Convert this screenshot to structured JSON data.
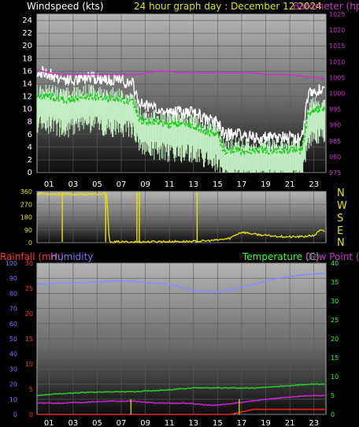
{
  "header": {
    "wind_title": "Windspeed (kts)",
    "graph_title": "24 hour graph day : December 12 2024",
    "barometer_title": "Barometer (hpa)"
  },
  "bottom_header": {
    "rainfall_title": "Rainfall (mm)",
    "humidity_title": "Humidity",
    "temperature_title": "Temperature (C)",
    "dewpoint_title": "Dew Point (C)"
  },
  "compass": [
    "N",
    "W",
    "S",
    "E",
    "N"
  ],
  "hour_labels": [
    "01",
    "03",
    "05",
    "07",
    "09",
    "11",
    "13",
    "15",
    "17",
    "19",
    "21",
    "23"
  ],
  "colors": {
    "wind_gust": "#ffffff",
    "wind_avg_band": "#c8f5c8",
    "wind_avg_line": "#22cc22",
    "barometer": "#cc33cc",
    "direction": "#e5e500",
    "humidity": "#8a8aff",
    "temperature": "#22cc22",
    "dewpoint": "#cc22cc",
    "rainfall": "#ee2222",
    "rain_axis": "#ff3333",
    "humidity_axis": "#7777ff",
    "temp_axis": "#33ff33"
  },
  "chart_data": [
    {
      "type": "line",
      "panel": "wind",
      "x_hours": [
        0,
        1,
        2,
        3,
        4,
        5,
        6,
        7,
        8,
        8.5,
        9,
        10,
        11,
        12,
        13,
        14,
        15,
        15.5,
        16,
        17,
        18,
        19,
        20,
        21,
        22,
        22.5,
        23,
        23.8
      ],
      "series": [
        {
          "name": "Windspeed (kts)",
          "values_gust": [
            16,
            15.5,
            15,
            14.5,
            15,
            15,
            14.5,
            14.5,
            14,
            11,
            10.5,
            10,
            9.5,
            9.5,
            9.5,
            8.5,
            8,
            6,
            6,
            6,
            5.5,
            5.5,
            5.5,
            5.5,
            5.5,
            12,
            13,
            13
          ]
        },
        {
          "name": "Average",
          "values_avg": [
            12,
            12,
            11.5,
            11.5,
            12,
            12,
            11.5,
            11.5,
            11,
            8.5,
            8,
            8,
            7.5,
            7.5,
            7.5,
            6.5,
            6,
            3.5,
            3.5,
            3.5,
            3.5,
            3.5,
            3.5,
            3.5,
            3.5,
            9,
            10,
            10
          ]
        },
        {
          "name": "Barometer (hpa)",
          "values_baro": [
            1007.5,
            1006.5,
            1006,
            1006,
            1006,
            1006,
            1006,
            1006,
            1006,
            1006,
            1006.5,
            1007,
            1007,
            1006.5,
            1006.5,
            1006.5,
            1006.5,
            1006.5,
            1006.5,
            1006.5,
            1006.5,
            1006,
            1006,
            1006,
            1005.5,
            1005,
            1005,
            1004.5
          ]
        }
      ],
      "ylim_left": [
        0,
        25
      ],
      "yticks_left": [
        0,
        2,
        4,
        6,
        8,
        10,
        12,
        14,
        16,
        18,
        20,
        22,
        24
      ],
      "ylim_right": [
        975,
        1025
      ],
      "yticks_right": [
        975,
        980,
        985,
        990,
        995,
        1000,
        1005,
        1010,
        1015,
        1020,
        1025
      ]
    },
    {
      "type": "line",
      "panel": "direction",
      "x_hours": [
        0,
        2,
        4,
        5.8,
        6,
        6.5,
        8,
        8.4,
        8.6,
        10,
        12,
        13.5,
        14,
        15,
        16,
        16.5,
        17,
        18,
        19,
        20,
        21,
        22,
        23,
        23.5,
        23.9
      ],
      "values_deg": [
        345,
        340,
        340,
        340,
        5,
        5,
        5,
        5,
        5,
        8,
        8,
        10,
        12,
        18,
        30,
        55,
        75,
        60,
        50,
        45,
        40,
        42,
        50,
        85,
        80
      ],
      "spikes_hours": [
        2.1,
        5.7,
        8.3,
        8.5,
        13.3
      ],
      "ylim": [
        0,
        360
      ],
      "yticks": [
        0,
        90,
        180,
        270,
        360
      ]
    },
    {
      "type": "line",
      "panel": "humidity_temp",
      "x_hours": [
        0,
        2,
        4,
        6,
        8,
        9,
        10,
        11,
        12,
        13,
        14,
        15,
        16,
        17,
        18,
        19,
        20,
        21,
        22,
        23,
        23.9
      ],
      "series": [
        {
          "name": "Humidity",
          "values": [
            86,
            87,
            87,
            88,
            88,
            87,
            87,
            86,
            84,
            82,
            81,
            81,
            82,
            84,
            86,
            88,
            90,
            91,
            92,
            93,
            93
          ]
        },
        {
          "name": "Temperature (C)",
          "values": [
            5,
            5.5,
            5.8,
            6,
            6,
            6.2,
            6.3,
            6.5,
            6.8,
            7,
            7,
            7,
            7,
            7,
            7,
            7.2,
            7.4,
            7.6,
            7.8,
            8,
            8
          ]
        },
        {
          "name": "Dew Point (C)",
          "values": [
            3,
            3,
            3.2,
            3.5,
            3.5,
            3.2,
            3,
            3,
            3,
            2.8,
            2.5,
            2.5,
            2.8,
            3.2,
            3.6,
            4,
            4.3,
            4.6,
            4.8,
            5,
            5
          ]
        },
        {
          "name": "Rainfall (mm)",
          "values": [
            0,
            0,
            0,
            0,
            0,
            0,
            0,
            0,
            0,
            0,
            0,
            0,
            0,
            0.5,
            1,
            1,
            1,
            1,
            1,
            1,
            1
          ]
        }
      ],
      "rain_spikes_hours": [
        7.8,
        16.8
      ],
      "ylim_humidity": [
        0,
        100
      ],
      "yticks_humidity": [
        0,
        10,
        20,
        30,
        40,
        50,
        60,
        70,
        80,
        90,
        100
      ],
      "ylim_rain": [
        0,
        30
      ],
      "yticks_rain": [
        0,
        5,
        10,
        15,
        20,
        25,
        30
      ],
      "ylim_temp": [
        0,
        40
      ],
      "yticks_temp": [
        0,
        5,
        10,
        15,
        20,
        25,
        30,
        35,
        40
      ]
    }
  ]
}
